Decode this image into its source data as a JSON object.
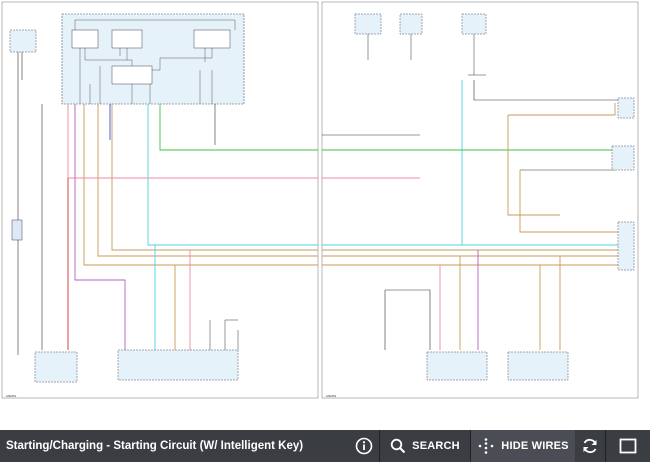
{
  "diagram": {
    "left_page_code": "A90251",
    "right_page_code": "A90252"
  },
  "toolbar": {
    "title": "Starting/Charging - Starting Circuit (W/ Intelligent Key)",
    "search_label": "SEARCH",
    "hide_wires_label": "HIDE WIRES"
  },
  "colors": {
    "toolbar_bg": "#3a3d42",
    "wire_green": "#3fc23f",
    "wire_pink": "#f08aa0",
    "wire_cyan": "#4fd0e0",
    "wire_tan": "#c89a5a",
    "wire_blue": "#3a4fd0",
    "wire_purple": "#b060c0",
    "wire_red": "#d03030",
    "module_fill": "#e6f2fa"
  }
}
